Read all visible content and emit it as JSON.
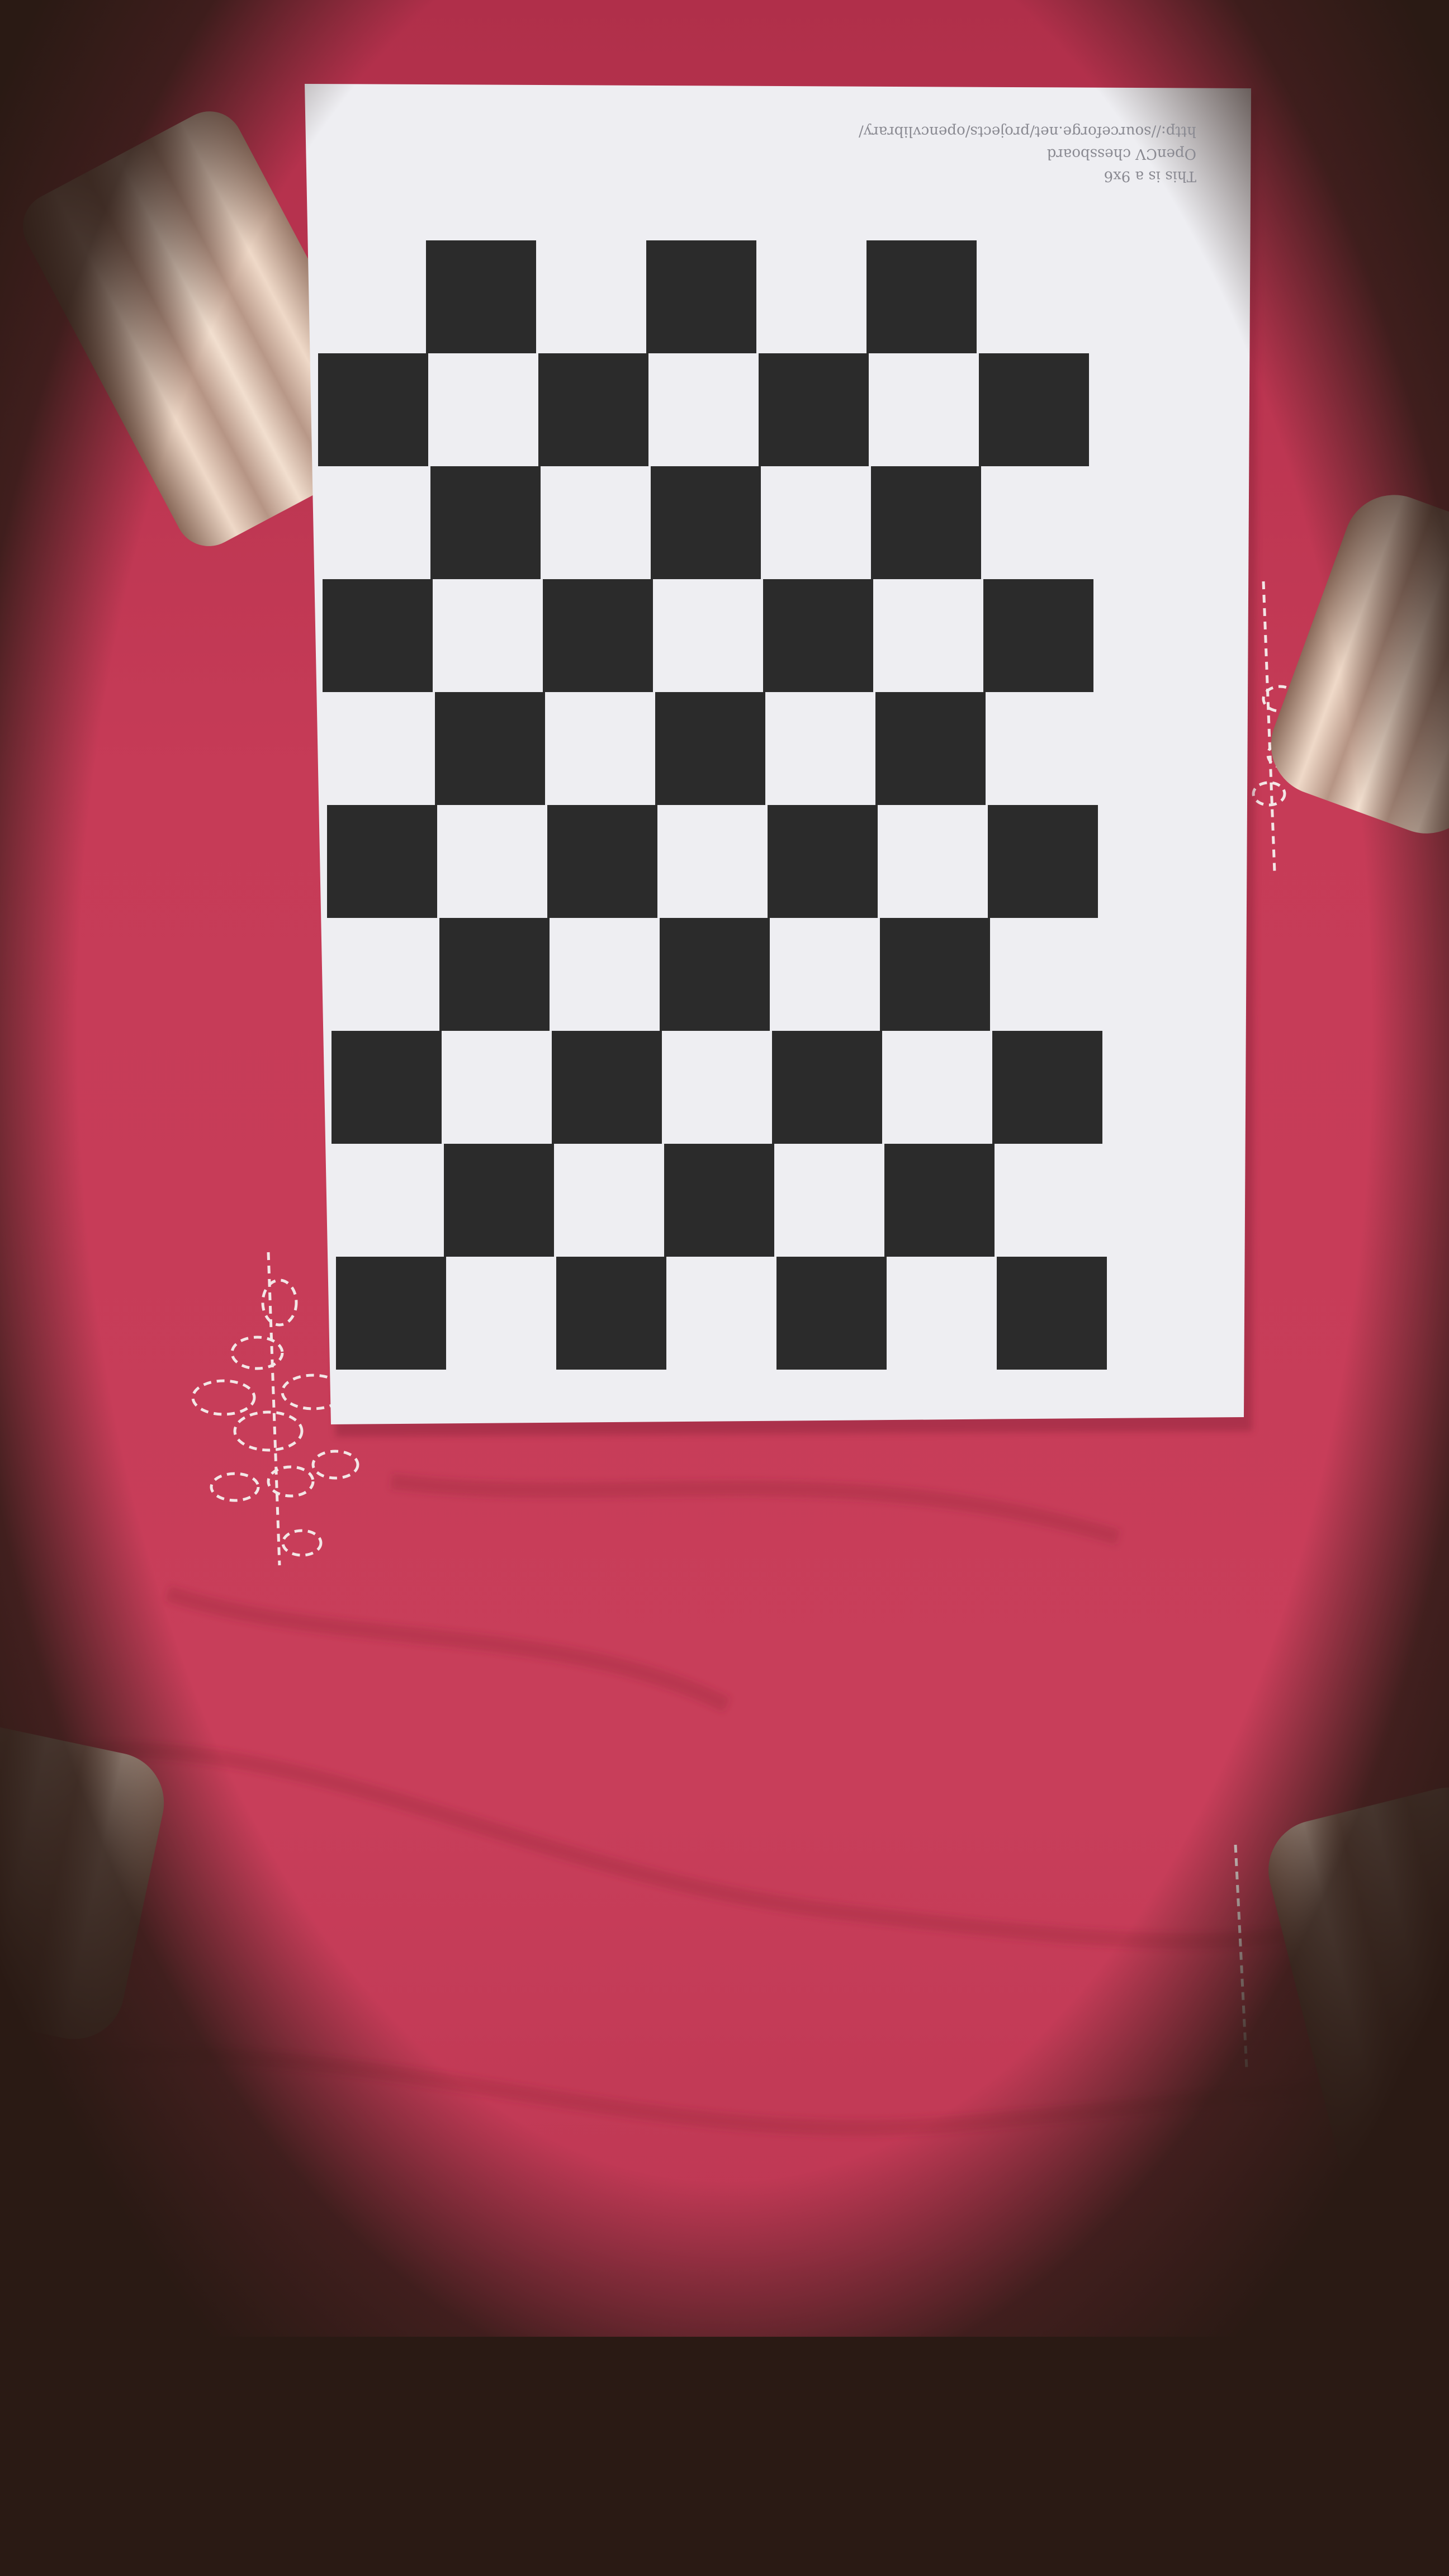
{
  "photo": {
    "subject": "printed OpenCV calibration chessboard on red cloth",
    "paper_caption": [
      "This is a 9x6",
      "OpenCV chessboard",
      "http://sourceforge.net/projects/opencvlibrary/"
    ]
  },
  "colors": {
    "cloth": "#c63b57",
    "cloth_dark": "#a92a45",
    "paper": "#eeeef2",
    "square": "#2b2b2b",
    "candle": "#e7d0bf",
    "vignette": "#2a1a14",
    "embroidery": "#f3e6e6"
  },
  "icons": [
    "candle-holder-icon",
    "embroidery-pattern-icon"
  ]
}
